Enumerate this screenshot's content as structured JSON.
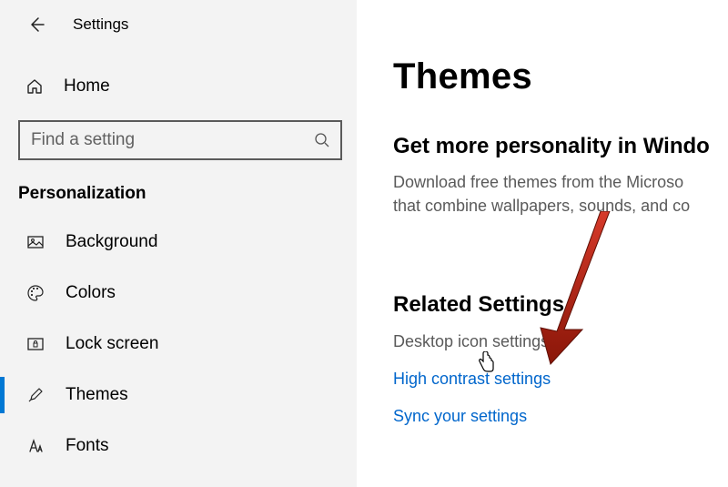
{
  "topbar": {
    "title": "Settings"
  },
  "home": {
    "label": "Home"
  },
  "search": {
    "placeholder": "Find a setting"
  },
  "section": {
    "header": "Personalization"
  },
  "nav": {
    "items": [
      {
        "label": "Background"
      },
      {
        "label": "Colors"
      },
      {
        "label": "Lock screen"
      },
      {
        "label": "Themes"
      },
      {
        "label": "Fonts"
      }
    ]
  },
  "main": {
    "title": "Themes",
    "store_heading": "Get more personality in Windo",
    "store_desc_line1": "Download free themes from the Microso",
    "store_desc_line2": "that combine wallpapers, sounds, and co",
    "related_heading": "Related Settings",
    "related_links": [
      {
        "label": "Desktop icon settings"
      },
      {
        "label": "High contrast settings"
      },
      {
        "label": "Sync your settings"
      }
    ]
  }
}
